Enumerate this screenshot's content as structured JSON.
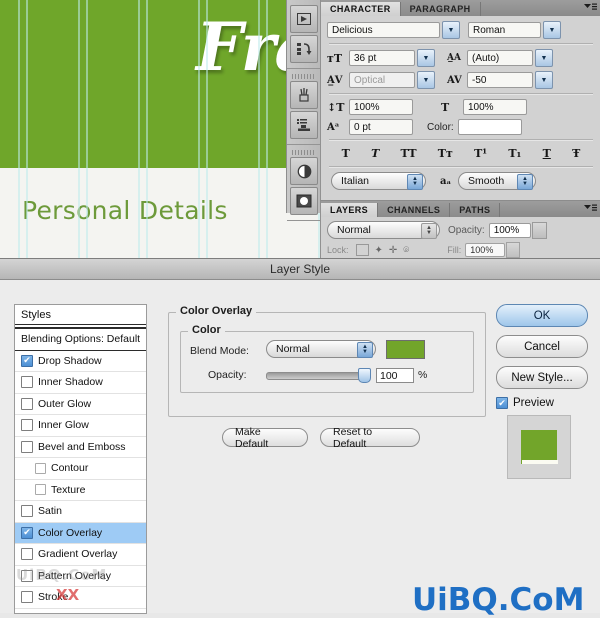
{
  "canvas": {
    "heading_text": "Fra",
    "section_title": "Personal Details",
    "green_hex": "#6fa62a",
    "stripe_hex": "#bdeaea",
    "title_color": "#ffffff",
    "section_color": "#6d9a3a"
  },
  "dock": {
    "items": [
      {
        "name": "animation-panel-icon",
        "glyph": "▶"
      },
      {
        "name": "actions-panel-icon",
        "glyph": "⤷"
      },
      {
        "name": "brushes-panel-icon",
        "glyph": "✐"
      },
      {
        "name": "tool-presets-panel-icon",
        "glyph": "≡"
      },
      {
        "name": "adjustments-panel-icon",
        "glyph": "◐"
      },
      {
        "name": "masks-panel-icon",
        "glyph": "◉"
      }
    ]
  },
  "character_panel": {
    "tabs": [
      {
        "label": "CHARACTER",
        "active": true
      },
      {
        "label": "PARAGRAPH",
        "active": false
      }
    ],
    "font_family": "Delicious",
    "font_style": "Roman",
    "font_size": "36 pt",
    "leading": "(Auto)",
    "kerning": "Optical",
    "tracking": "-50",
    "vertical_scale": "100%",
    "horizontal_scale": "100%",
    "baseline_shift": "0 pt",
    "color_label": "Color:",
    "color_value": "#ffffff",
    "language": "Italian",
    "antialias": "Smooth",
    "style_buttons": [
      "T",
      "T",
      "TT",
      "Tᴛ",
      "T¹",
      "T₁",
      "T",
      "Ŧ"
    ],
    "icons": {
      "size": "ᴛT",
      "leading": "A̲A",
      "kerning": "A̲V",
      "tracking": "AV",
      "vscale": "↕T",
      "hscale": "T",
      "baseline": "Aᵃ",
      "antialias": "aₐ"
    }
  },
  "layers_panel": {
    "tabs": [
      {
        "label": "LAYERS",
        "active": true
      },
      {
        "label": "CHANNELS",
        "active": false
      },
      {
        "label": "PATHS",
        "active": false
      }
    ],
    "blend_mode": "Normal",
    "opacity_label": "Opacity:",
    "opacity_value": "100%",
    "fill_label": "Fill:",
    "fill_value": "100%"
  },
  "dialog": {
    "title": "Layer Style",
    "styles_list": {
      "header": "Styles",
      "blending_options": "Blending Options: Default",
      "items": [
        {
          "label": "Drop Shadow",
          "checked": true,
          "sub": false,
          "selected": false
        },
        {
          "label": "Inner Shadow",
          "checked": false,
          "sub": false,
          "selected": false
        },
        {
          "label": "Outer Glow",
          "checked": false,
          "sub": false,
          "selected": false
        },
        {
          "label": "Inner Glow",
          "checked": false,
          "sub": false,
          "selected": false
        },
        {
          "label": "Bevel and Emboss",
          "checked": false,
          "sub": false,
          "selected": false
        },
        {
          "label": "Contour",
          "checked": false,
          "sub": true,
          "selected": false
        },
        {
          "label": "Texture",
          "checked": false,
          "sub": true,
          "selected": false
        },
        {
          "label": "Satin",
          "checked": false,
          "sub": false,
          "selected": false
        },
        {
          "label": "Color Overlay",
          "checked": true,
          "sub": false,
          "selected": true
        },
        {
          "label": "Gradient Overlay",
          "checked": false,
          "sub": false,
          "selected": false
        },
        {
          "label": "Pattern Overlay",
          "checked": false,
          "sub": false,
          "selected": false
        },
        {
          "label": "Stroke",
          "checked": false,
          "sub": false,
          "selected": false
        }
      ]
    },
    "color_overlay": {
      "group_title": "Color Overlay",
      "sub_group_title": "Color",
      "blend_mode_label": "Blend Mode:",
      "blend_mode_value": "Normal",
      "swatch_color": "#72a52a",
      "opacity_label": "Opacity:",
      "opacity_value": "100",
      "opacity_unit": "%",
      "make_default": "Make Default",
      "reset_to_default": "Reset to Default"
    },
    "buttons": {
      "ok": "OK",
      "cancel": "Cancel",
      "new_style": "New Style...",
      "preview": "Preview",
      "preview_color": "#72a52a"
    }
  },
  "watermark": {
    "main": "UiBQ.CoM",
    "sub": "　",
    "faint": "UiBQ.CoM",
    "x_mark": "XX",
    "color": "#1f6fc4"
  }
}
